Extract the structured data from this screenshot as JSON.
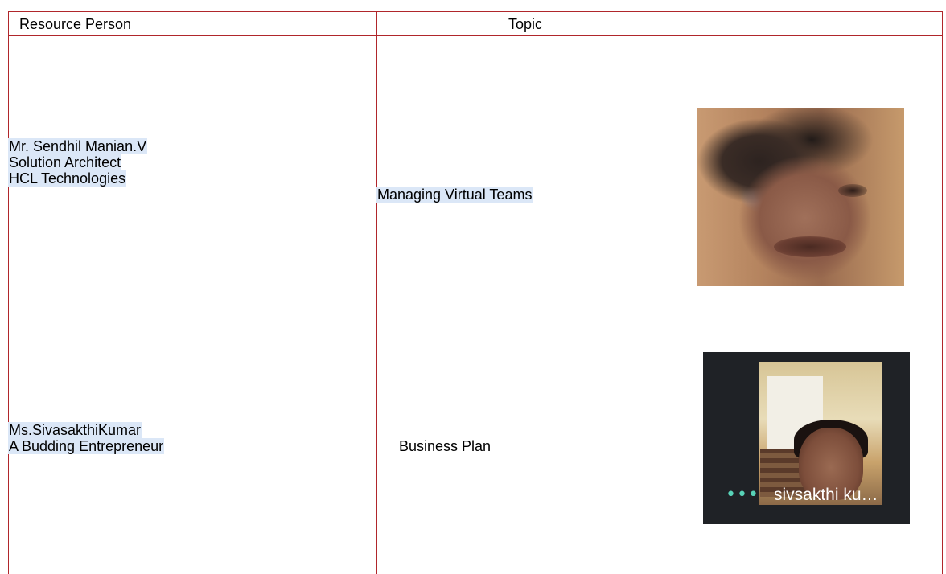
{
  "table": {
    "headers": [
      "Resource Person",
      "Topic",
      ""
    ],
    "rows": [
      {
        "person_lines": [
          "Mr. Sendhil Manian.V",
          "Solution Architect",
          "HCL Technologies"
        ],
        "topic": "Managing Virtual Teams"
      },
      {
        "person_lines": [
          "Ms.SivasakthiKumar",
          "A Budding Entrepreneur"
        ],
        "topic": "Business Plan",
        "video_name_label": "sivsakthi ku…",
        "video_menu_icon": "more-dots-icon"
      }
    ]
  },
  "colors": {
    "border": "#b0262b",
    "text_highlight": "#dbe7f7",
    "video_dots": "#58d3b8"
  }
}
